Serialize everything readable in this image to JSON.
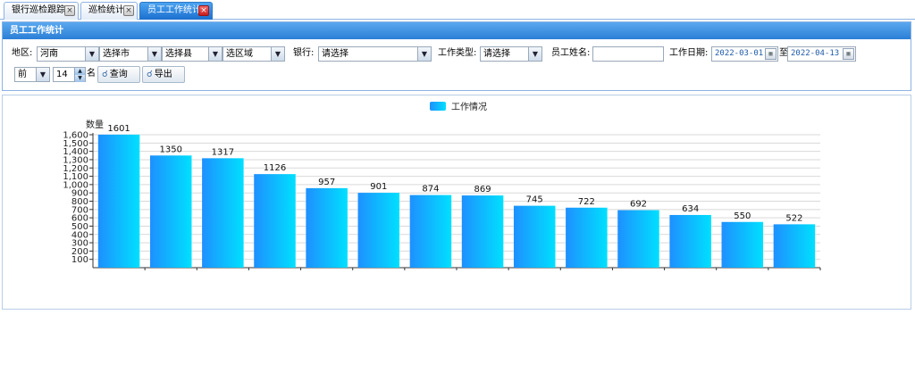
{
  "tabs": [
    {
      "label": "银行巡检跟踪",
      "close": "×",
      "active": false
    },
    {
      "label": "巡检统计",
      "close": "×",
      "active": false
    },
    {
      "label": "员工工作统计",
      "close": "×",
      "active": true
    }
  ],
  "panel": {
    "title": "员工工作统计"
  },
  "filters": {
    "region_label": "地区:",
    "province": "河南",
    "city": "选择市",
    "county": "选择县",
    "district": "选区域",
    "bank_label": "银行:",
    "bank": "请选择",
    "work_type_label": "工作类型:",
    "work_type": "请选择",
    "employee_name_label": "员工姓名:",
    "employee_name": "",
    "date_label": "工作日期:",
    "date_from": "2022-03-01",
    "date_sep": "至",
    "date_to": "2022-04-13",
    "rank_order": "前",
    "rank_count": "14",
    "rank_unit": "名",
    "query_button": "查询",
    "export_button": "导出"
  },
  "icons": {
    "dropdown": "dropdown-arrow-icon",
    "calendar": "calendar-icon",
    "search": "magnifier-icon",
    "close": "close-icon"
  },
  "colors": {
    "accent": "#2a7fd6",
    "bar_left": "#1e90ff",
    "bar_right": "#00e0ff",
    "tab_active": "#1b6fcf"
  },
  "chart_data": {
    "type": "bar",
    "legend": "工作情况",
    "legend_position": "top-center",
    "ylabel": "数量",
    "xlabel": "",
    "ylim": [
      0,
      1600
    ],
    "ytick_step": 100,
    "ytick_labels": [
      "100",
      "200",
      "300",
      "400",
      "500",
      "600",
      "700",
      "800",
      "900",
      "1,000",
      "1,100",
      "1,200",
      "1,300",
      "1,400",
      "1,500",
      "1,600"
    ],
    "grid": true,
    "categories": [
      "",
      "",
      "",
      "",
      "",
      "",
      "",
      "",
      "",
      "",
      "",
      "",
      "",
      ""
    ],
    "values": [
      1601,
      1350,
      1317,
      1126,
      957,
      901,
      874,
      869,
      745,
      722,
      692,
      634,
      550,
      522
    ],
    "value_labels": [
      "1601",
      "1350",
      "1317",
      "1126",
      "957",
      "901",
      "874",
      "869",
      "745",
      "722",
      "692",
      "634",
      "550",
      "522"
    ]
  }
}
